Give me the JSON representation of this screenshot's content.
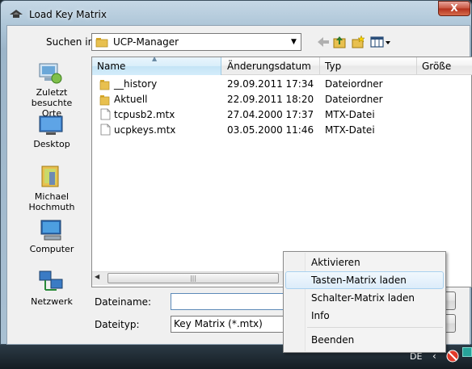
{
  "window": {
    "title": "Load Key Matrix",
    "close": "X"
  },
  "lookin": {
    "label": "Suchen in:",
    "value": "UCP-Manager"
  },
  "places": [
    {
      "line1": "Zuletzt besuchte",
      "line2": "Orte"
    },
    {
      "line1": "Desktop",
      "line2": ""
    },
    {
      "line1": "Michael",
      "line2": "Hochmuth"
    },
    {
      "line1": "Computer",
      "line2": ""
    },
    {
      "line1": "Netzwerk",
      "line2": ""
    }
  ],
  "columns": {
    "name": "Name",
    "date": "Änderungsdatum",
    "type": "Typ",
    "size": "Größe"
  },
  "files": [
    {
      "name": "__history",
      "date": "29.09.2011 17:34",
      "type": "Dateiordner",
      "kind": "folder"
    },
    {
      "name": "Aktuell",
      "date": "22.09.2011 18:20",
      "type": "Dateiordner",
      "kind": "folder"
    },
    {
      "name": "tcpusb2.mtx",
      "date": "27.04.2000 17:37",
      "type": "MTX-Datei",
      "kind": "file"
    },
    {
      "name": "ucpkeys.mtx",
      "date": "03.05.2000 11:46",
      "type": "MTX-Datei",
      "kind": "file"
    }
  ],
  "filename": {
    "label": "Dateiname:",
    "value": ""
  },
  "filetype": {
    "label": "Dateityp:",
    "value": "Key Matrix (*.mtx)"
  },
  "context_menu": {
    "items": [
      "Aktivieren",
      "Tasten-Matrix laden",
      "Schalter-Matrix laden",
      "Info",
      "Beenden"
    ],
    "highlighted": "Tasten-Matrix laden"
  },
  "taskbar": {
    "language": "DE",
    "chevron": "‹"
  },
  "colors": {
    "folder": "#e8c04f",
    "highlight": "#dcecfa",
    "close": "#c8553f"
  },
  "icons": {
    "scroll_grip": "|||",
    "scroll_left": "◀",
    "dropdown": "▼"
  }
}
